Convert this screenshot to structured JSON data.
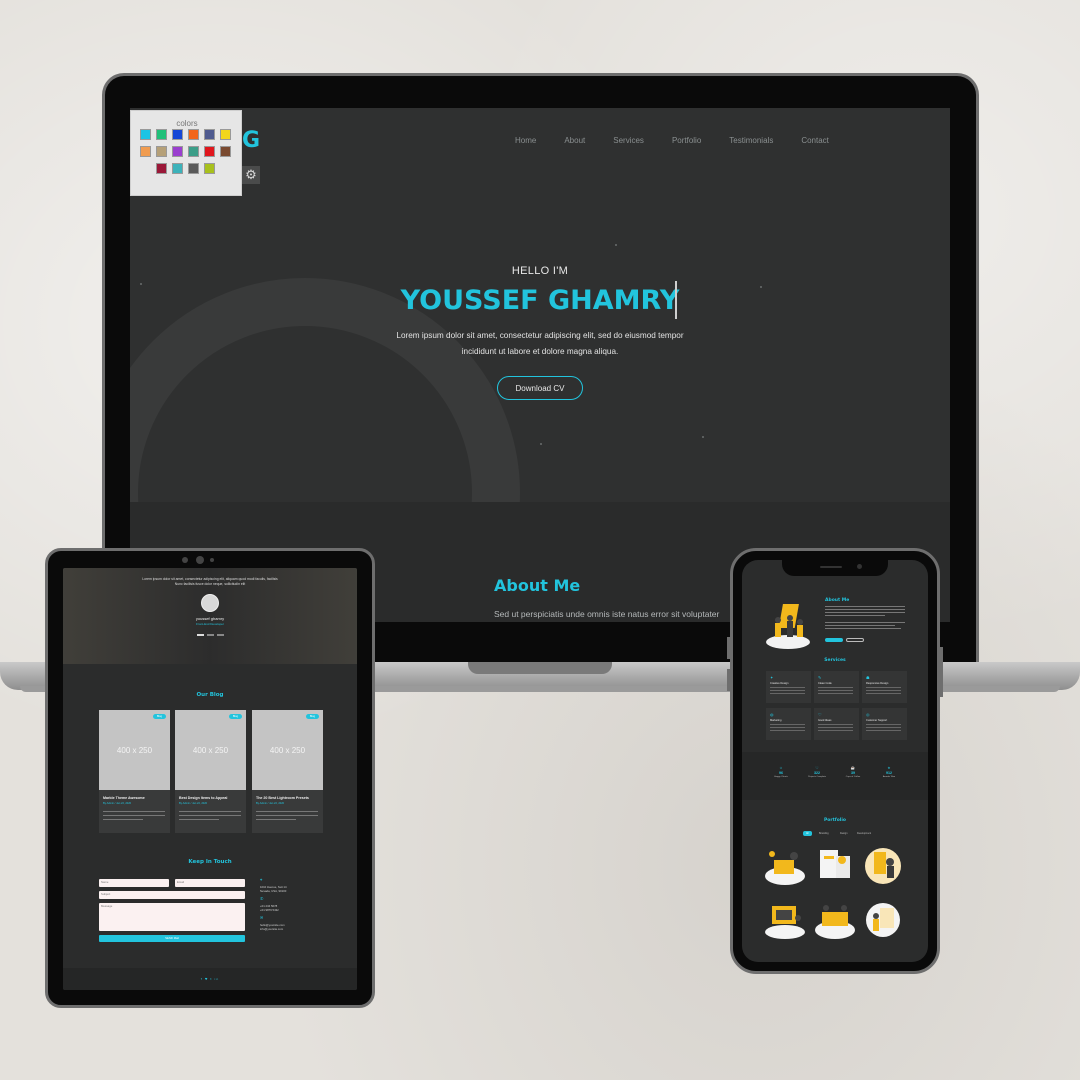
{
  "colors": {
    "accent": "#22c4dd",
    "panel_swatches": [
      "#1cc4e4",
      "#22c07a",
      "#1546d6",
      "#f2661a",
      "#4e5a8f",
      "#f2d61c",
      "#f09c50",
      "#b5a078",
      "#9a3fcf",
      "#3c9e88",
      "#e0161c",
      "#7a4a30",
      "#9a1838",
      "#3cb2ba",
      "#5a5a5a",
      "#a8c01c"
    ]
  },
  "laptop": {
    "logo": "G",
    "nav": [
      "Home",
      "About",
      "Services",
      "Portfolio",
      "Testimonials",
      "Contact"
    ],
    "color_panel": {
      "title": "colors",
      "gear_icon": "gear-icon"
    },
    "hero": {
      "greeting": "HELLO I'M",
      "name": "YOUSSEF GHAMRY",
      "description_line1": "Lorem ipsum dolor sit amet, consectetur adipiscing elit, sed do eiusmod tempor",
      "description_line2": "incididunt ut labore et dolore magna aliqua.",
      "button": "Download CV"
    },
    "about": {
      "title": "About Me",
      "text": "Sed ut perspiciatis unde omnis iste natus error sit voluptater"
    }
  },
  "tablet": {
    "testimonial": {
      "quote_line1": "Lorem ipsum dolor sit amet, consectetur adipiscing elit, aliquam quod modi faculis, facilisis",
      "quote_line2": "Nunc facilisis fusce dolor neque, sollicitudin elit",
      "name": "youssef ghamry",
      "role": "Front-End Developer"
    },
    "blog": {
      "title": "Our Blog",
      "cards": [
        {
          "image_text": "400 x 250",
          "tag": "Blog",
          "title": "Marble Theme Awesome",
          "meta": "By Admin / Jan 22, 2020"
        },
        {
          "image_text": "400 x 250",
          "tag": "Blog",
          "title": "Best Design Items to Appeal",
          "meta": "By Admin / Jan 22, 2020"
        },
        {
          "image_text": "400 x 250",
          "tag": "Blog",
          "title": "The 20 Best Lightroom Presets",
          "meta": "By Admin / Jan 22, 2020"
        }
      ]
    },
    "contact": {
      "title": "Keep In Touch",
      "placeholder_name": "Name",
      "placeholder_email": "Email",
      "placeholder_subject": "Subject",
      "placeholder_message": "Message",
      "send_button": "SEND Mail",
      "address_line1": "1010 Avenue, Suit 14",
      "address_line2": "Nevada, USA, 90100",
      "phone_line1": "+01 234 5678",
      "phone_line2": "+01 9876 5432",
      "email_line1": "hello@yoursite.com",
      "email_line2": "info@yoursite.com",
      "social": "f  ♥  t  in"
    }
  },
  "phone": {
    "about_title": "About Me",
    "services_title": "Services",
    "services": [
      {
        "icon": "✦",
        "title": "Creative Design"
      },
      {
        "icon": "✎",
        "title": "Clean Code"
      },
      {
        "icon": "☗",
        "title": "Responsive Design"
      },
      {
        "icon": "◍",
        "title": "Marketing"
      },
      {
        "icon": "♡",
        "title": "Good Ideas"
      },
      {
        "icon": "◎",
        "title": "Customer Support"
      }
    ],
    "stats": [
      {
        "icon": "☺",
        "number": "96",
        "label": "Happy Clients"
      },
      {
        "icon": "♡",
        "number": "322",
        "label": "Projects Complete"
      },
      {
        "icon": "☕",
        "number": "39",
        "label": "Cups of Coffee"
      },
      {
        "icon": "★",
        "number": "912",
        "label": "Awards Won"
      }
    ],
    "portfolio_title": "Portfolio",
    "filters": [
      "All",
      "Branding",
      "Design",
      "Development"
    ]
  }
}
